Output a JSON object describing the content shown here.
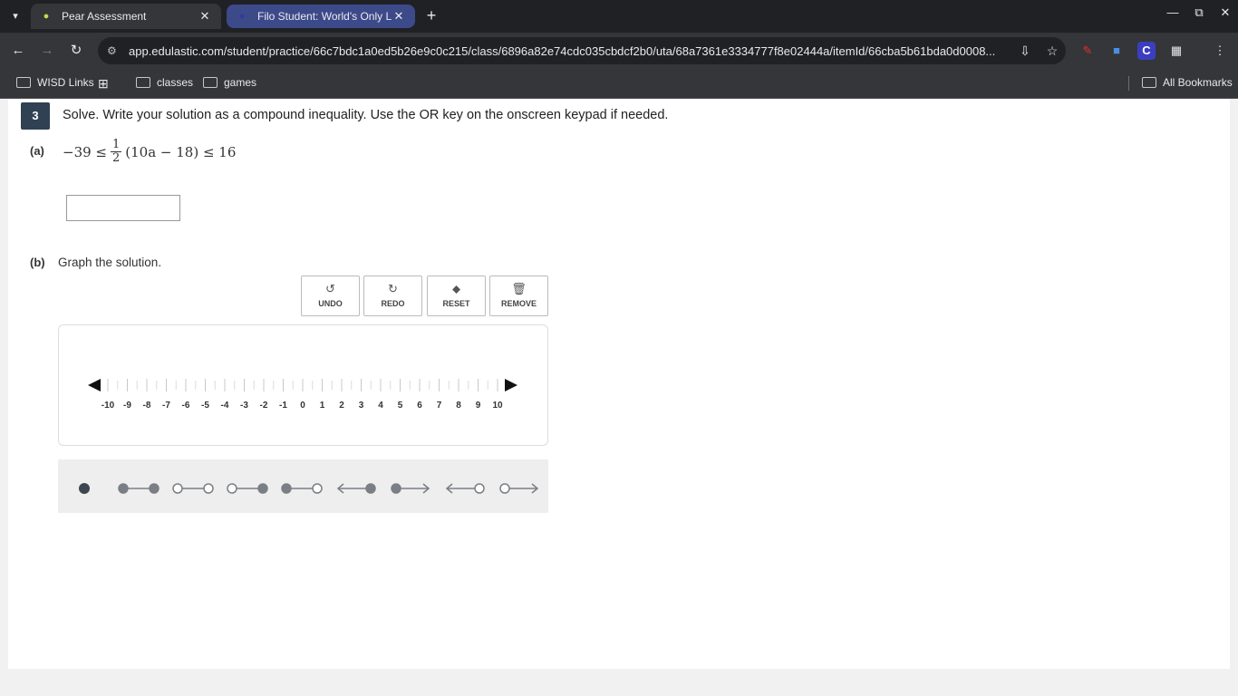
{
  "browser": {
    "tabs": [
      {
        "title": "Pear Assessment",
        "active": true
      },
      {
        "title": "Filo Student: World's Only Live",
        "active": false
      }
    ],
    "url": "app.edulastic.com/student/practice/66c7bdc1a0ed5b26e9c0c215/class/6896a82e74cdc035cbdcf2b0/uta/68a7361e3334777f8e02444a/itemId/66cba5b61bda0d0008...",
    "bookmarks": [
      "WISD Links",
      "classes",
      "games"
    ],
    "all_bookmarks": "All Bookmarks"
  },
  "question": {
    "number": "3",
    "text": "Solve.  Write your solution as a compound inequality. Use the OR key on the onscreen keypad if needed.",
    "part_a_label": "(a)",
    "math": {
      "left": "−39 ≤",
      "frac_num": "1",
      "frac_den": "2",
      "right": "(10a − 18) ≤ 16"
    },
    "answer_value": "",
    "part_b_label": "(b)",
    "part_b_text": "Graph the solution."
  },
  "tools": {
    "undo": "UNDO",
    "redo": "REDO",
    "reset": "RESET",
    "remove": "REMOVE"
  },
  "number_line": {
    "min": -10,
    "max": 10,
    "tick_labels": [
      "-10",
      "-9",
      "-8",
      "-7",
      "-6",
      "-5",
      "-4",
      "-3",
      "-2",
      "-1",
      "0",
      "1",
      "2",
      "3",
      "4",
      "5",
      "6",
      "7",
      "8",
      "9",
      "10"
    ]
  },
  "palette": {
    "items": [
      "point",
      "segment-closed-closed",
      "segment-open-open",
      "segment-open-closed",
      "segment-closed-open",
      "ray-left-closed",
      "ray-right-closed",
      "ray-left-open",
      "ray-right-open"
    ]
  },
  "colors": {
    "question_badge": "#2f4153",
    "palette_mark": "#7a7f85",
    "palette_point": "#3d4752"
  }
}
